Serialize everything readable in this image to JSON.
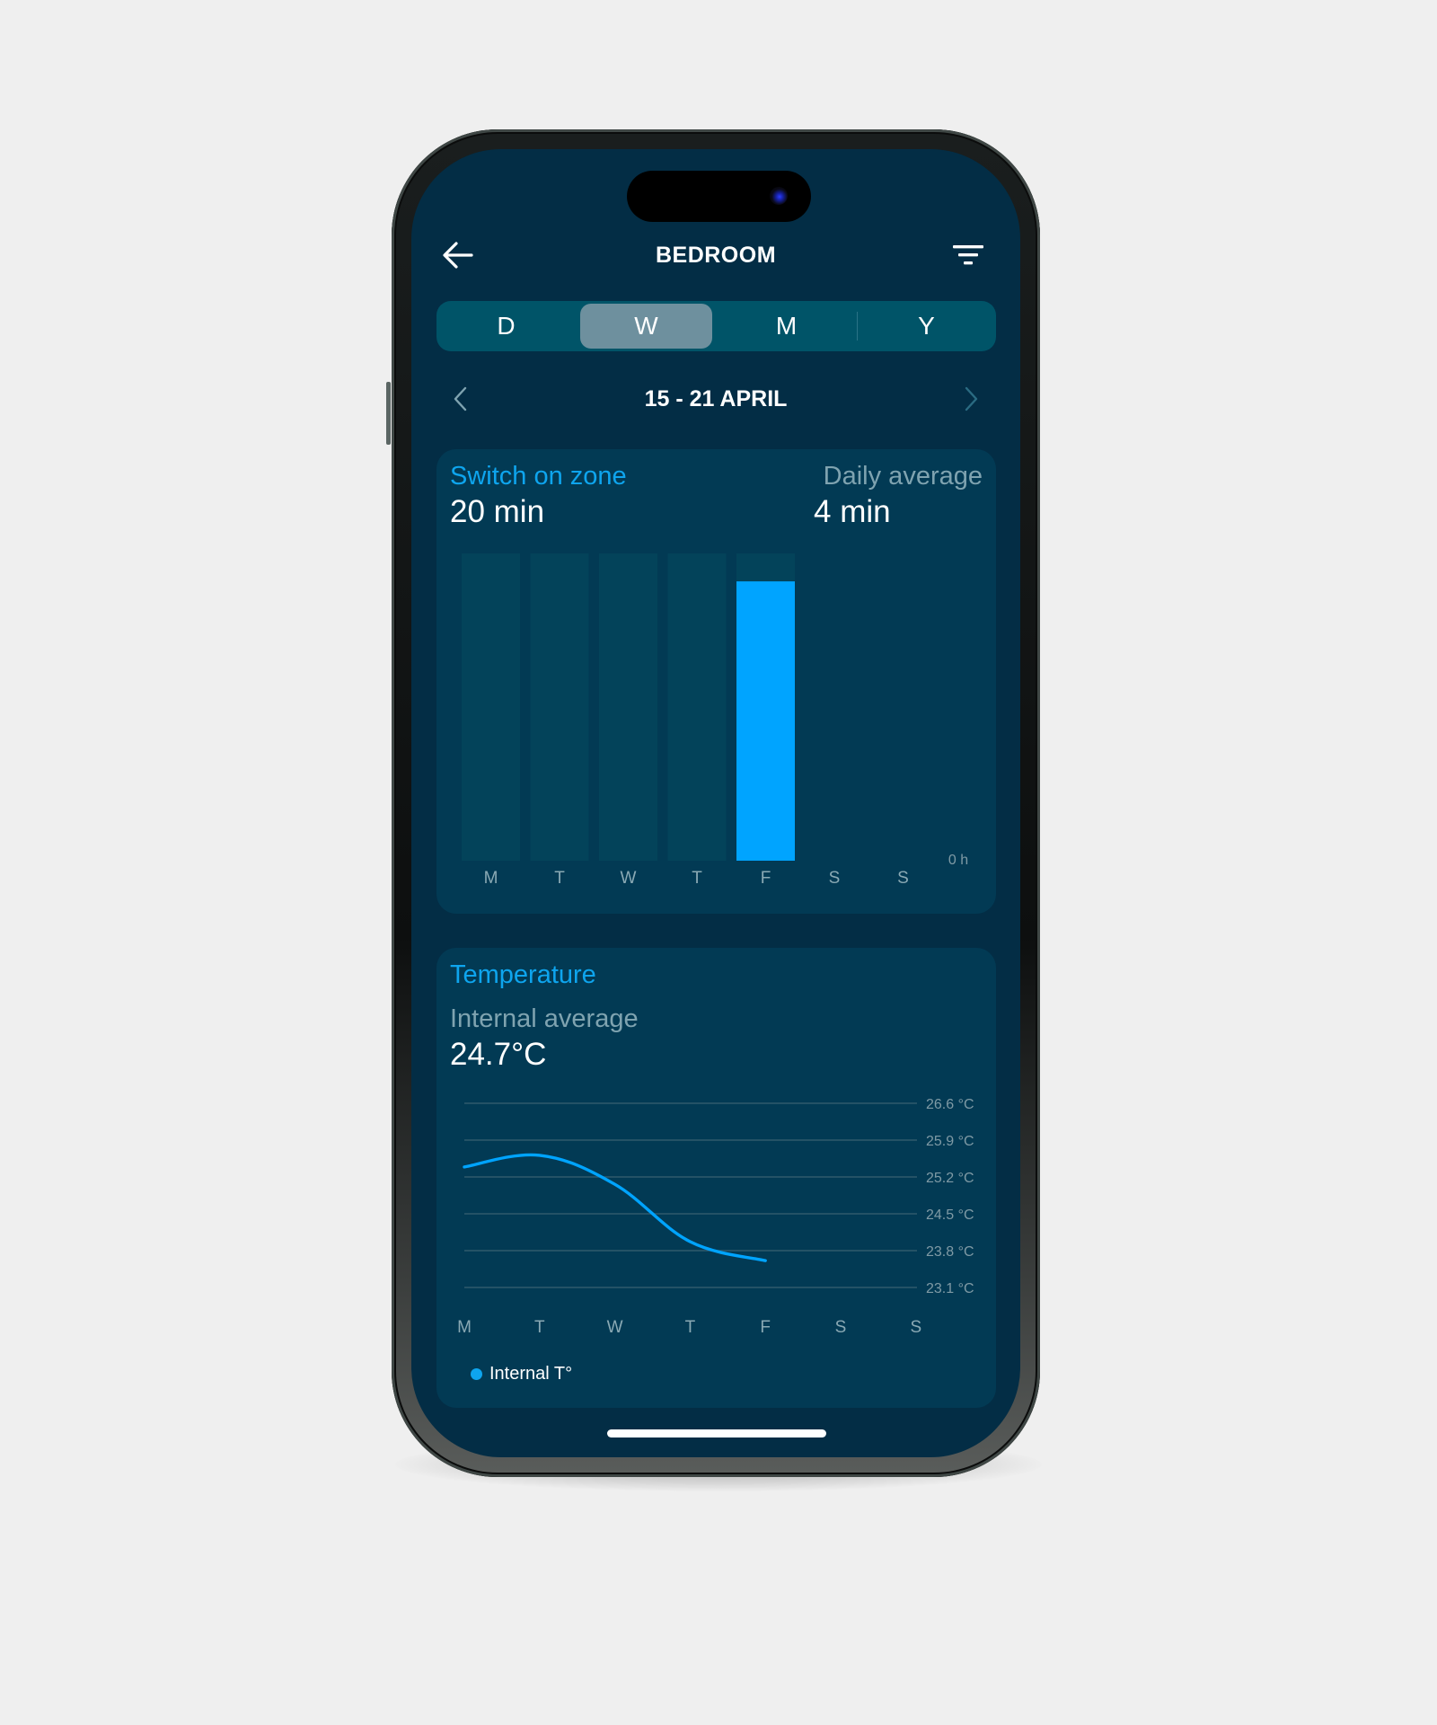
{
  "header": {
    "title": "BEDROOM",
    "back_icon": "arrow-left-icon",
    "filter_icon": "filter-icon"
  },
  "period_tabs": [
    {
      "label": "D",
      "active": false
    },
    {
      "label": "W",
      "active": true
    },
    {
      "label": "M",
      "active": false
    },
    {
      "label": "Y",
      "active": false
    }
  ],
  "date_range": {
    "label": "15 - 21 APRIL",
    "prev_icon": "chevron-left-icon",
    "next_icon": "chevron-right-icon"
  },
  "switch_card": {
    "title": "Switch on zone",
    "total_value": "20 min",
    "avg_label": "Daily average",
    "avg_value": "4 min"
  },
  "temperature_card": {
    "title": "Temperature",
    "avg_label": "Internal average",
    "avg_value": "24.7°C",
    "legend_label": "Internal T°"
  },
  "colors": {
    "accent": "#00a4ff",
    "screen_bg": "#032d45",
    "card_bg": "#023a54",
    "bar_track": "#03435a"
  },
  "chart_data": [
    {
      "type": "bar",
      "title": "Switch on zone",
      "categories": [
        "M",
        "T",
        "W",
        "T",
        "F",
        "S",
        "S"
      ],
      "values": [
        0,
        0,
        0,
        0,
        20,
        null,
        null
      ],
      "unit": "min",
      "track_max": 22,
      "has_track": [
        true,
        true,
        true,
        true,
        true,
        false,
        false
      ],
      "highlight_index": 4,
      "y_tick_labels": [
        "0 h"
      ],
      "xlabel": "",
      "ylabel": ""
    },
    {
      "type": "line",
      "title": "Temperature",
      "categories": [
        "M",
        "T",
        "W",
        "T",
        "F",
        "S",
        "S"
      ],
      "series": [
        {
          "name": "Internal T°",
          "values": [
            25.39,
            25.61,
            25.06,
            23.97,
            23.61,
            null,
            null
          ],
          "color": "#00a4ff"
        }
      ],
      "y_ticks": [
        26.6,
        25.9,
        25.2,
        24.5,
        23.8,
        23.1
      ],
      "y_tick_labels": [
        "26.6 °C",
        "25.9 °C",
        "25.2 °C",
        "24.5 °C",
        "23.8 °C",
        "23.1 °C"
      ],
      "ylim": [
        23.1,
        26.6
      ],
      "grid": true,
      "legend": "bottom-left",
      "xlabel": "",
      "ylabel": ""
    }
  ]
}
